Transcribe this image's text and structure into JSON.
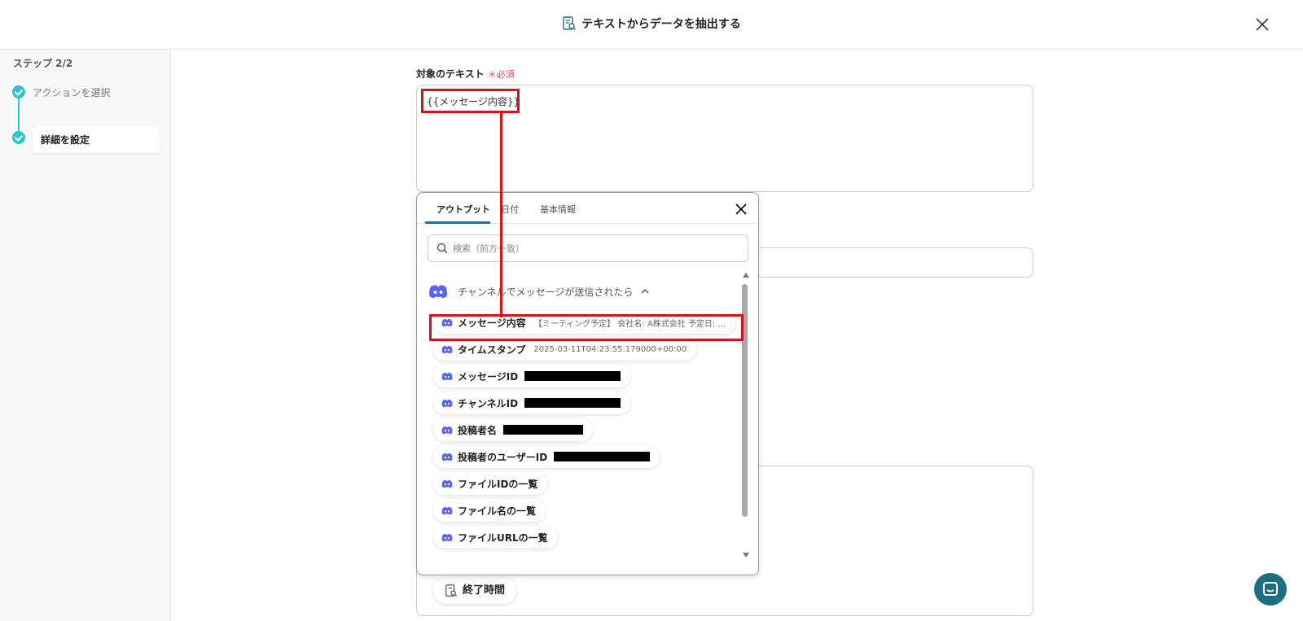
{
  "header": {
    "title": "テキストからデータを抽出する"
  },
  "sidebar": {
    "step_label": "ステップ 2/2",
    "steps": [
      {
        "label": "アクションを選択"
      },
      {
        "label": "詳細を設定"
      }
    ]
  },
  "field": {
    "label": "対象のテキスト",
    "required_mark": "＊",
    "required_text": "必須",
    "value": "{{メッセージ内容}}"
  },
  "popup": {
    "tabs": [
      {
        "label": "アウトプット"
      },
      {
        "label": "日付"
      },
      {
        "label": "基本情報"
      }
    ],
    "search": {
      "placeholder": "検索（前方一致）"
    },
    "group": {
      "label": "チャンネルでメッセージが送信されたら"
    },
    "items": [
      {
        "name": "メッセージ内容",
        "value": "【ミーティング予定】 会社名: A株式会社 予定日: ..."
      },
      {
        "name": "タイムスタンプ",
        "value": "2025-03-11T04:23:55.179000+00:00"
      },
      {
        "name": "メッセージID"
      },
      {
        "name": "チャンネルID"
      },
      {
        "name": "投稿者名"
      },
      {
        "name": "投稿者のユーザーID"
      },
      {
        "name": "ファイルIDの一覧"
      },
      {
        "name": "ファイル名の一覧"
      },
      {
        "name": "ファイルURLの一覧"
      }
    ]
  },
  "below": {
    "end_time": "終了時間"
  },
  "colors": {
    "accent": "#2ec4c8",
    "highlight": "#d0161c",
    "discord": "#5865f2",
    "fab": "#1f6e7f"
  }
}
